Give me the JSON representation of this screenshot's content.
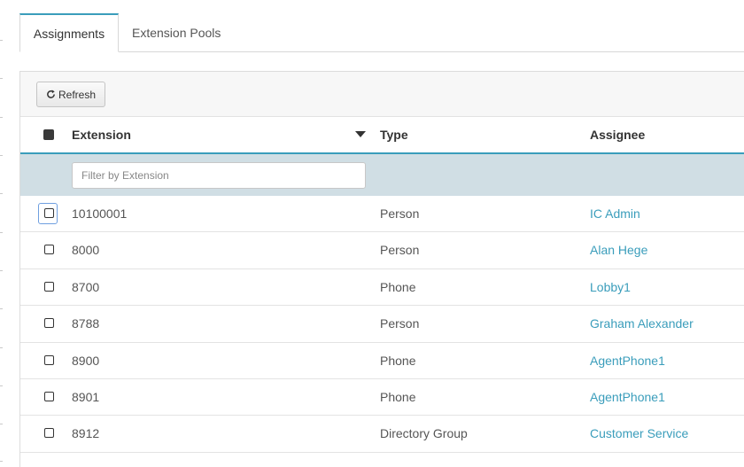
{
  "tabs": [
    {
      "label": "Assignments",
      "active": true
    },
    {
      "label": "Extension Pools",
      "active": false
    }
  ],
  "toolbar": {
    "refresh_label": "Refresh",
    "refresh_icon": "refresh-icon"
  },
  "table": {
    "columns": [
      "Extension",
      "Type",
      "Assignee"
    ],
    "sort_column": "Extension",
    "filter": {
      "placeholder": "Filter by Extension",
      "value": ""
    },
    "rows": [
      {
        "extension": "10100001",
        "type": "Person",
        "assignee": "IC Admin"
      },
      {
        "extension": "8000",
        "type": "Person",
        "assignee": "Alan Hege"
      },
      {
        "extension": "8700",
        "type": "Phone",
        "assignee": "Lobby1"
      },
      {
        "extension": "8788",
        "type": "Person",
        "assignee": "Graham Alexander"
      },
      {
        "extension": "8900",
        "type": "Phone",
        "assignee": "AgentPhone1"
      },
      {
        "extension": "8901",
        "type": "Phone",
        "assignee": "AgentPhone1"
      },
      {
        "extension": "8912",
        "type": "Directory Group",
        "assignee": "Customer Service"
      }
    ]
  },
  "colors": {
    "accent": "#3a9dbb",
    "filter_row_bg": "#d0dee4",
    "link": "#3a9dbb"
  }
}
